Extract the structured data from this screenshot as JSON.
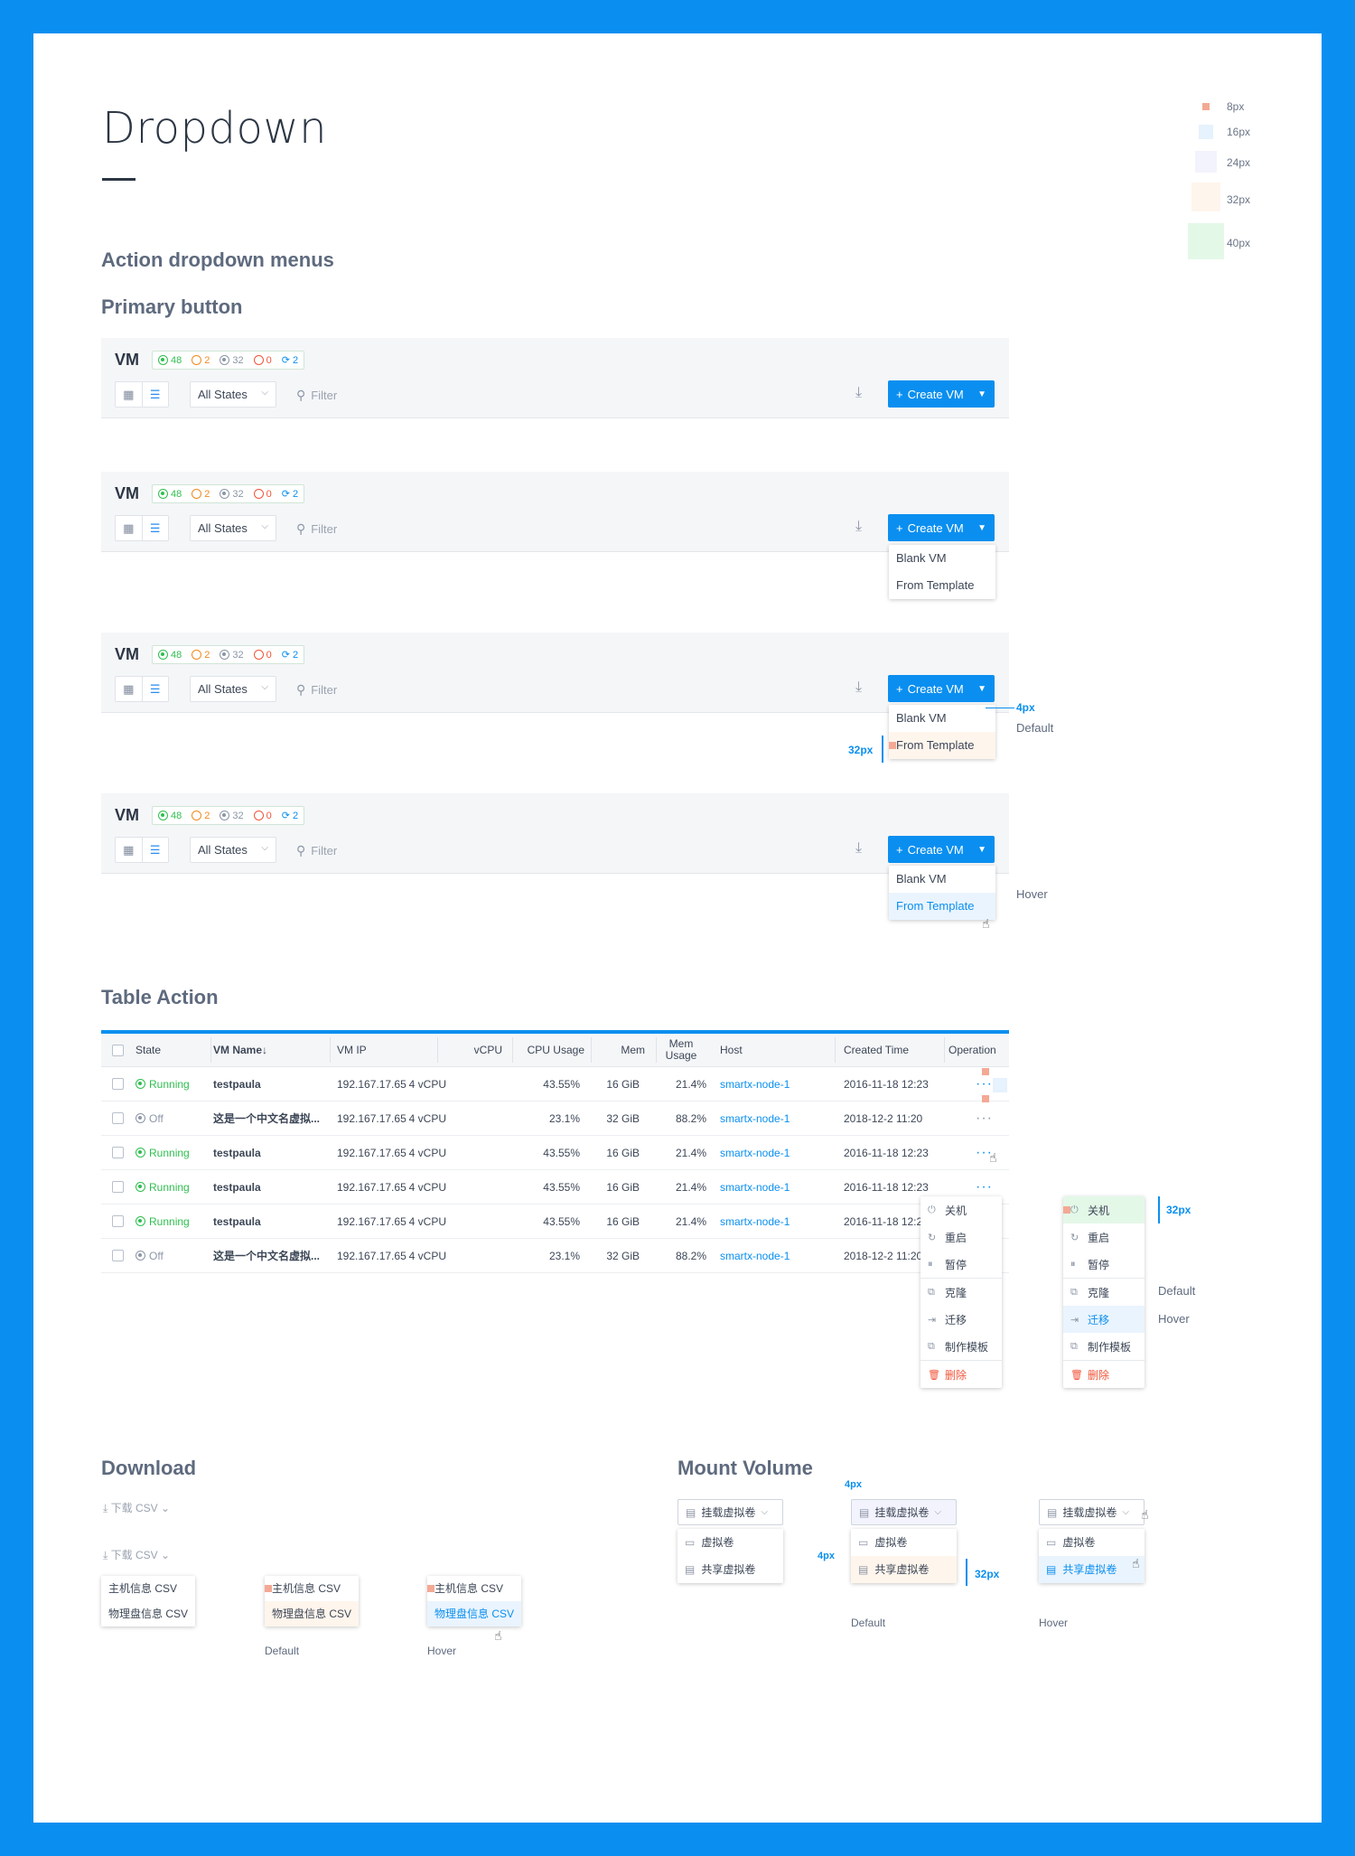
{
  "page": {
    "title": "Dropdown"
  },
  "legend": [
    {
      "label": "8px",
      "color": "#f3a994"
    },
    {
      "label": "16px",
      "color": "#e6f2fd"
    },
    {
      "label": "24px",
      "color": "#f3f3fd"
    },
    {
      "label": "32px",
      "color": "#fef5ec"
    },
    {
      "label": "40px",
      "color": "#e4f8e8"
    }
  ],
  "sections": {
    "action_menus": "Action dropdown menus",
    "primary_button": "Primary button",
    "table_action": "Table Action",
    "download": "Download",
    "mount_volume": "Mount Volume"
  },
  "vm_panel": {
    "title": "VM",
    "stats": {
      "running": "48",
      "paused": "2",
      "stopped": "32",
      "error": "0",
      "pending": "2"
    },
    "state_select": "All States",
    "filter_placeholder": "Filter",
    "create_button": "Create VM",
    "menu": [
      "Blank VM",
      "From Template"
    ]
  },
  "annotations": {
    "px4": "4px",
    "px32": "32px",
    "default": "Default",
    "hover": "Hover"
  },
  "table": {
    "headers": [
      "State",
      "VM Name",
      "VM IP",
      "vCPU",
      "CPU Usage",
      "Mem",
      "Mem Usage",
      "Host",
      "Created Time",
      "Operation"
    ],
    "rows": [
      {
        "state": "Running",
        "name": "testpaula",
        "ip": "192.167.17.65",
        "vcpu": "4 vCPU",
        "cpu": "43.55%",
        "mem": "16 GiB",
        "memu": "21.4%",
        "host": "smartx-node-1",
        "time": "2016-11-18 12:23"
      },
      {
        "state": "Off",
        "name": "这是一个中文名虚拟...",
        "ip": "192.167.17.65",
        "vcpu": "4 vCPU",
        "cpu": "23.1%",
        "mem": "32 GiB",
        "memu": "88.2%",
        "host": "smartx-node-1",
        "time": "2018-12-2 11:20"
      },
      {
        "state": "Running",
        "name": "testpaula",
        "ip": "192.167.17.65",
        "vcpu": "4 vCPU",
        "cpu": "43.55%",
        "mem": "16 GiB",
        "memu": "21.4%",
        "host": "smartx-node-1",
        "time": "2016-11-18 12:23"
      },
      {
        "state": "Running",
        "name": "testpaula",
        "ip": "192.167.17.65",
        "vcpu": "4 vCPU",
        "cpu": "43.55%",
        "mem": "16 GiB",
        "memu": "21.4%",
        "host": "smartx-node-1",
        "time": "2016-11-18 12:23"
      },
      {
        "state": "Running",
        "name": "testpaula",
        "ip": "192.167.17.65",
        "vcpu": "4 vCPU",
        "cpu": "43.55%",
        "mem": "16 GiB",
        "memu": "21.4%",
        "host": "smartx-node-1",
        "time": "2016-11-18 12:23"
      },
      {
        "state": "Off",
        "name": "这是一个中文名虚拟...",
        "ip": "192.167.17.65",
        "vcpu": "4 vCPU",
        "cpu": "23.1%",
        "mem": "32 GiB",
        "memu": "88.2%",
        "host": "smartx-node-1",
        "time": "2018-12-2 11:20"
      }
    ],
    "op_menu": [
      "关机",
      "重启",
      "暂停",
      "克隆",
      "迁移",
      "制作模板",
      "删除"
    ]
  },
  "download": {
    "button": "下载 CSV",
    "menu": [
      "主机信息 CSV",
      "物理盘信息 CSV"
    ]
  },
  "mount": {
    "button": "挂载虚拟卷",
    "menu": [
      "虚拟卷",
      "共享虚拟卷"
    ]
  },
  "colors": {
    "accent": "#0a8ff0",
    "running": "#2fbf4f",
    "paused": "#f08a1c",
    "stopped": "#8c96a6",
    "error": "#f0553a",
    "danger": "#f0553a"
  }
}
